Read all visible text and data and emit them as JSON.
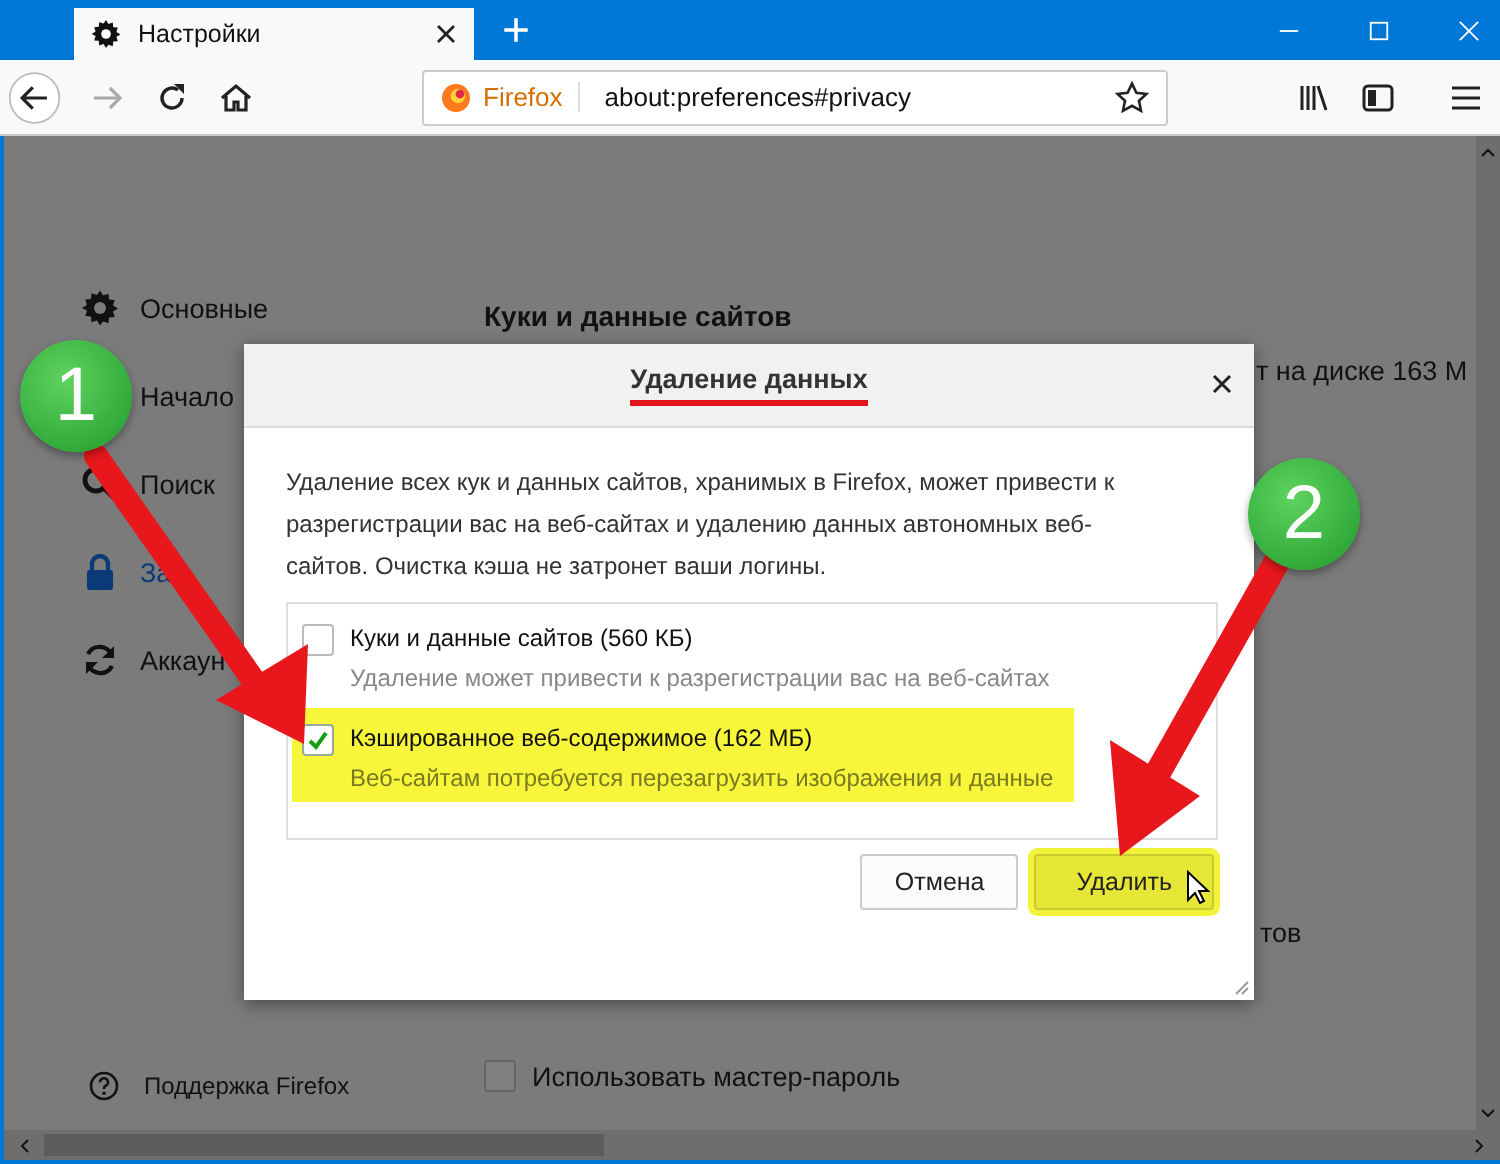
{
  "browser": {
    "tab": {
      "title": "Настройки"
    },
    "new_tab": "+",
    "address": {
      "identity": "Firefox",
      "url": "about:preferences#privacy"
    }
  },
  "sidebar": {
    "items": [
      {
        "lines": [
          "Основные"
        ],
        "selected": false
      },
      {
        "lines": [
          "Начало"
        ],
        "selected": false
      },
      {
        "lines": [
          "Поиск"
        ],
        "selected": false
      },
      {
        "lines": [
          "За"
        ],
        "selected": true
      },
      {
        "lines": [
          "Аккаун"
        ],
        "selected": false
      }
    ],
    "support": "Поддержка Firefox"
  },
  "page": {
    "heading": "Куки и данные сайтов",
    "fragment_1": "т на диске 163 М",
    "fragment_2": "тов",
    "master_password": {
      "label": "Использовать мастер-пароль",
      "checked": false
    }
  },
  "dialog": {
    "title": "Удаление данных",
    "title_underlined": true,
    "message": "Удаление всех кук и данных сайтов, хранимых в Firefox, может привести к разрегистрации вас на веб-сайтах и удалению данных автономных веб-сайтов. Очистка кэша не затронет ваши логины.",
    "options": [
      {
        "label": "Куки и данные сайтов (560 КБ)",
        "description": "Удаление может привести к разрегистрации вас на веб-сайтах",
        "checked": false,
        "highlighted": false
      },
      {
        "label": "Кэшированное веб-содержимое (162 МБ)",
        "description": "Веб-сайтам потребуется перезагрузить изображения и данные",
        "checked": true,
        "highlighted": true
      }
    ],
    "buttons": [
      {
        "label": "Отмена",
        "kind": "cancel",
        "highlighted": false
      },
      {
        "label": "Удалить",
        "kind": "confirm",
        "highlighted": true
      }
    ]
  },
  "annotations": {
    "badges": [
      {
        "number": "1"
      },
      {
        "number": "2"
      }
    ]
  }
}
